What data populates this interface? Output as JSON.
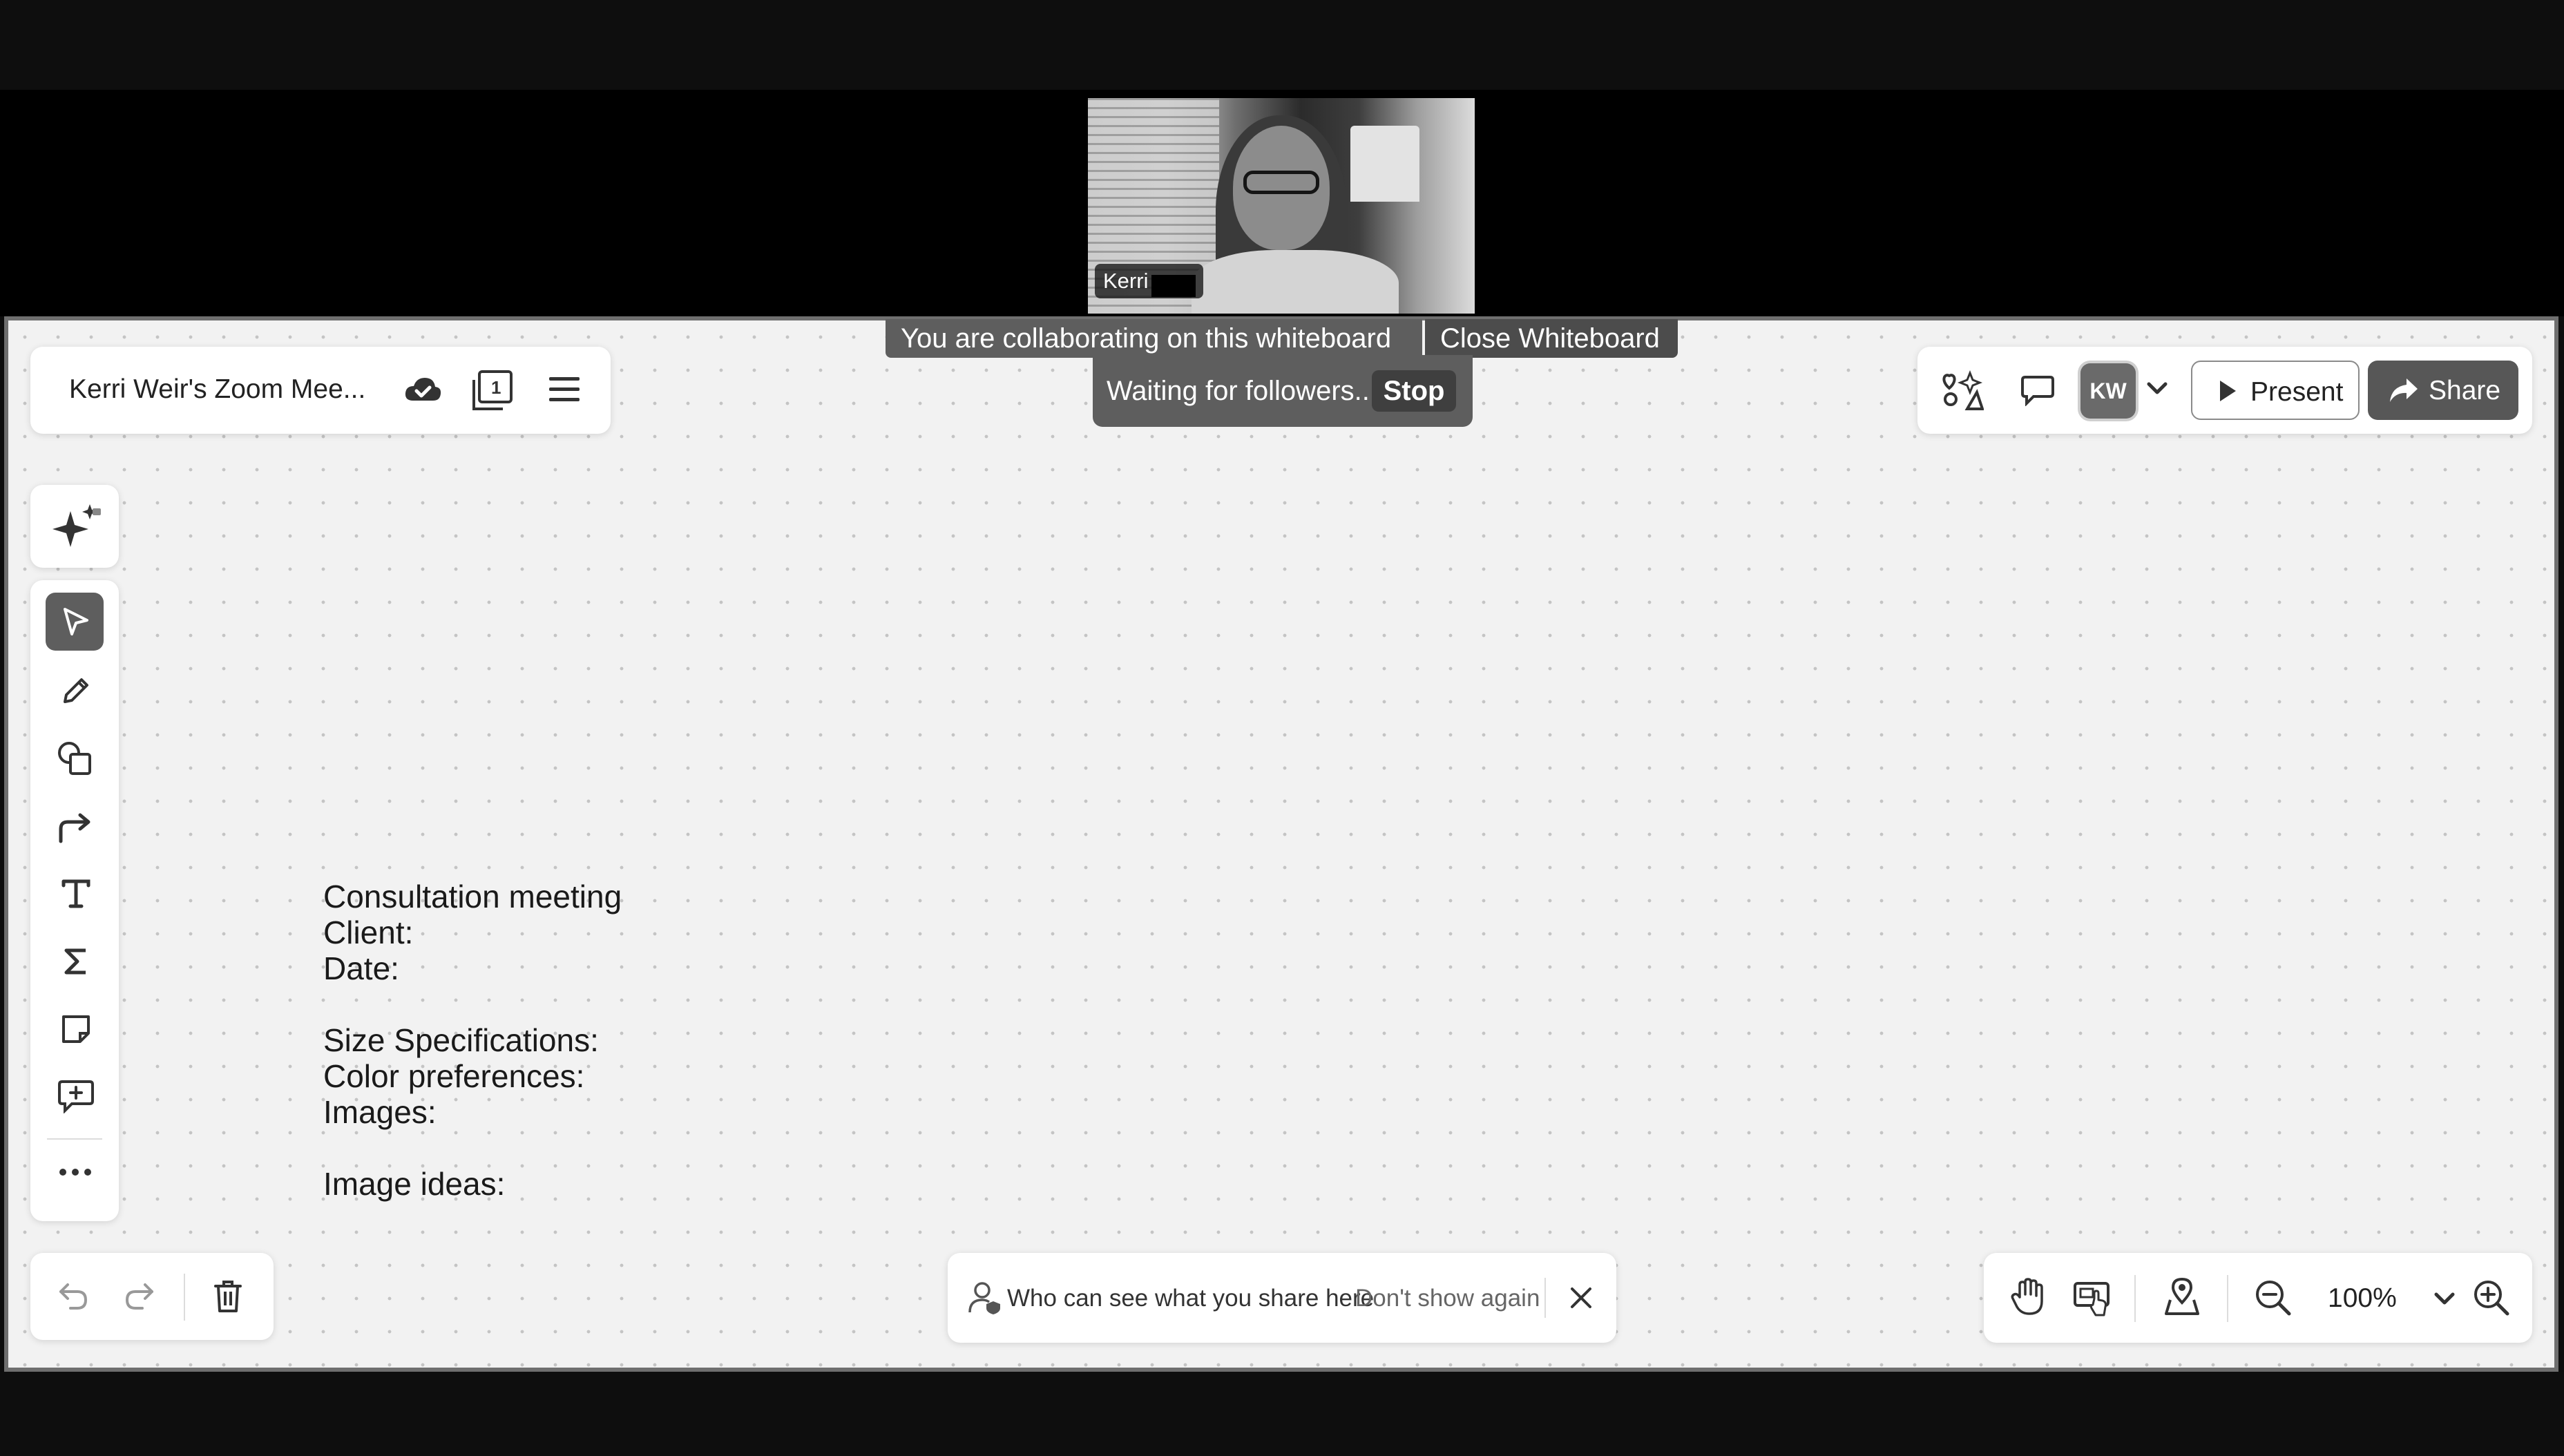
{
  "video": {
    "participant_name": "Kerri"
  },
  "banners": {
    "collaborating": "You are collaborating on this whiteboard",
    "close_whiteboard": "Close Whiteboard",
    "waiting": "Waiting for followers...",
    "stop": "Stop"
  },
  "header": {
    "board_title": "Kerri Weir's Zoom Mee...",
    "icons": [
      "cloud-saved-icon",
      "pages-icon",
      "menu-icon"
    ],
    "page_count": "1"
  },
  "right_toolbar": {
    "avatar_initials": "KW",
    "present_label": "Present",
    "share_label": "Share",
    "icons": [
      "add-reaction-icon",
      "comments-icon",
      "chevron-down-icon",
      "play-icon",
      "share-arrow-icon"
    ]
  },
  "tools": [
    "ai-sparkle-icon",
    "select-tool-icon",
    "pen-tool-icon",
    "shapes-tool-icon",
    "connector-tool-icon",
    "text-tool-icon",
    "formula-tool-icon",
    "sticky-note-tool-icon",
    "comment-tool-icon",
    "more-tools-icon"
  ],
  "canvas": {
    "lines": [
      "Consultation meeting",
      "Client:",
      "Date:",
      "",
      "Size Specifications:",
      "Color preferences:",
      "Images:",
      "",
      "Image ideas:"
    ]
  },
  "notice": {
    "text": "Who can see what you share here",
    "dont_show": "Don't show again"
  },
  "zoom": {
    "level": "100%",
    "icons": [
      "hand-tool-icon",
      "follow-screen-icon",
      "location-pin-icon",
      "zoom-out-icon",
      "chevron-down-icon",
      "zoom-in-icon"
    ]
  }
}
